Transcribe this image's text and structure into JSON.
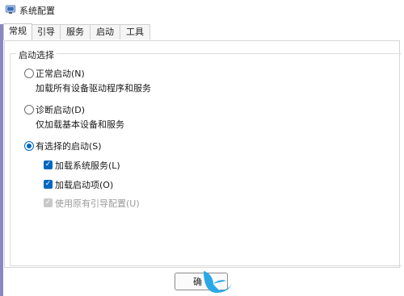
{
  "window": {
    "title": "系统配置"
  },
  "tabs": [
    {
      "label": "常规",
      "active": true
    },
    {
      "label": "引导",
      "active": false
    },
    {
      "label": "服务",
      "active": false
    },
    {
      "label": "启动",
      "active": false
    },
    {
      "label": "工具",
      "active": false
    }
  ],
  "startup_selection": {
    "legend": "启动选择",
    "normal": {
      "label": "正常启动(N)",
      "desc": "加载所有设备驱动程序和服务",
      "selected": false
    },
    "diagnostic": {
      "label": "诊断启动(D)",
      "desc": "仅加载基本设备和服务",
      "selected": false
    },
    "selective": {
      "label": "有选择的启动(S)",
      "selected": true,
      "options": [
        {
          "label": "加载系统服务(L)",
          "checked": true,
          "enabled": true
        },
        {
          "label": "加载启动项(O)",
          "checked": true,
          "enabled": true
        },
        {
          "label": "使用原有引导配置(U)",
          "checked": true,
          "enabled": false
        }
      ]
    }
  },
  "buttons": {
    "ok_label": "确"
  },
  "colors": {
    "accent": "#0067c0",
    "left_accent": "#8b87c4"
  }
}
